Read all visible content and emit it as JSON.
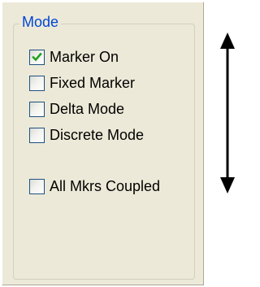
{
  "mode_group": {
    "title": "Mode",
    "options": [
      {
        "label": "Marker On",
        "checked": true
      },
      {
        "label": "Fixed Marker",
        "checked": false
      },
      {
        "label": "Delta Mode",
        "checked": false
      },
      {
        "label": "Discrete Mode",
        "checked": false
      },
      {
        "label": "All Mkrs Coupled",
        "checked": false
      }
    ]
  },
  "colors": {
    "panel_background": "#ece9d8",
    "legend_text": "#0046d5",
    "checkbox_border": "#1c5180",
    "checkmark": "#21a121"
  }
}
